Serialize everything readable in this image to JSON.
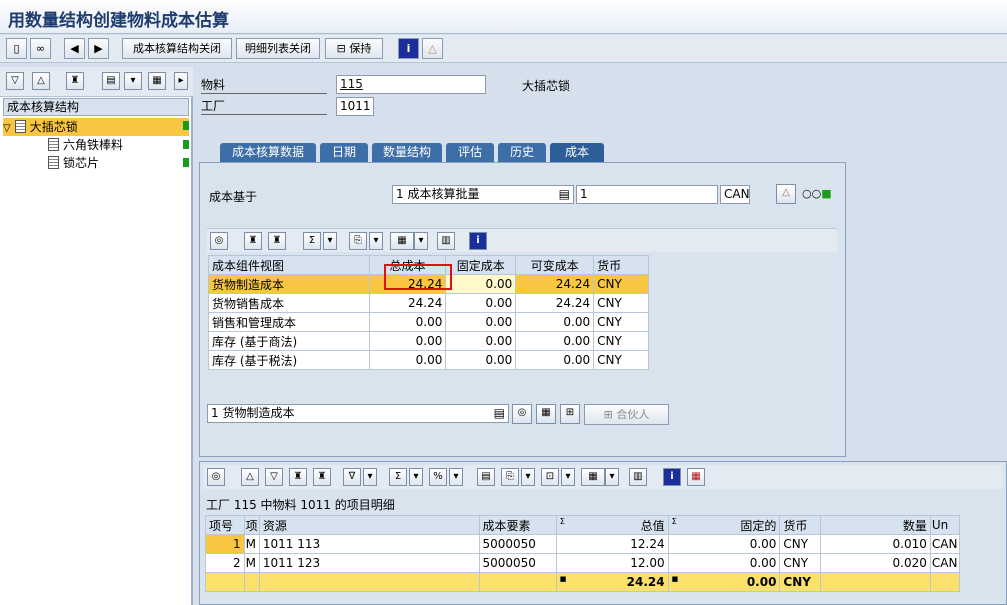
{
  "title": "用数量结构创建物料成本估算",
  "toolbar": {
    "btn_close_structure": "成本核算结构关闭",
    "btn_close_detail": "明细列表关闭",
    "btn_keep": "保持"
  },
  "left": {
    "header": "成本核算结构",
    "items": [
      "大插芯锁",
      "六角铁棒料",
      "锁芯片"
    ]
  },
  "form": {
    "material_label": "物料",
    "material_value": "115",
    "material_desc": "大插芯锁",
    "plant_label": "工厂",
    "plant_value": "1011"
  },
  "tabs": [
    "成本核算数据",
    "日期",
    "数量结构",
    "评估",
    "历史",
    "成本"
  ],
  "cost_base": {
    "label": "成本基于",
    "value": "1 成本核算批量",
    "qty": "1",
    "unit": "CAN"
  },
  "comp_table": {
    "headers": [
      "成本组件视图",
      "总成本",
      "固定成本",
      "可变成本",
      "货币"
    ],
    "rows": [
      [
        "货物制造成本",
        "24.24",
        "0.00",
        "24.24",
        "CNY"
      ],
      [
        "货物销售成本",
        "24.24",
        "0.00",
        "24.24",
        "CNY"
      ],
      [
        "销售和管理成本",
        "0.00",
        "0.00",
        "0.00",
        "CNY"
      ],
      [
        "库存 (基于商法)",
        "0.00",
        "0.00",
        "0.00",
        "CNY"
      ],
      [
        "库存 (基于税法)",
        "0.00",
        "0.00",
        "0.00",
        "CNY"
      ]
    ]
  },
  "view_select": "1 货物制造成本",
  "partner_btn": "合伙人",
  "detail": {
    "title": "工厂 115 中物料 1011 的项目明细",
    "headers": [
      "项号",
      "项",
      "资源",
      "成本要素",
      "总值",
      "固定的",
      "货币",
      "数量",
      "Un"
    ],
    "rows": [
      [
        "1",
        "M",
        "1011 113",
        "5000050",
        "12.24",
        "0.00",
        "CNY",
        "0.010",
        "CAN"
      ],
      [
        "2",
        "M",
        "1011 123",
        "5000050",
        "12.00",
        "0.00",
        "CNY",
        "0.020",
        "CAN"
      ]
    ],
    "total": {
      "value": "24.24",
      "fixed": "0.00",
      "currency": "CNY",
      "mark": "■"
    }
  }
}
